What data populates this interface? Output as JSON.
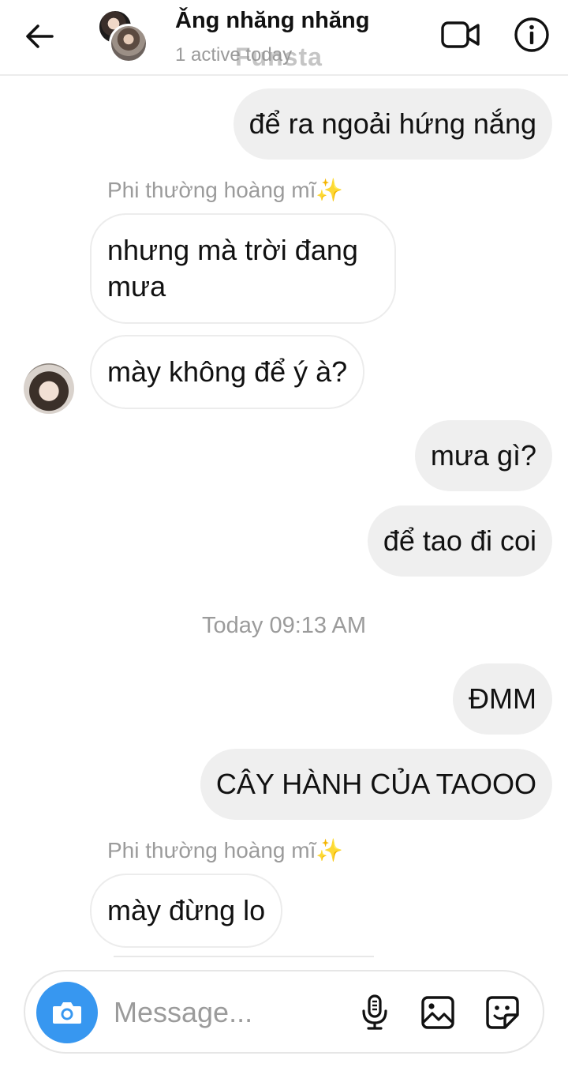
{
  "header": {
    "title": "Ǎng nhăng nhăng",
    "status": "1 active today",
    "watermark": "Funsta",
    "icons": [
      "back-arrow-icon",
      "video-call-icon",
      "info-icon"
    ]
  },
  "messages": [
    {
      "from": "me",
      "text": "để ra ngoải hứng nắng"
    },
    {
      "sender_label": "Phi thường hoàng mĩ",
      "sender_emoji": "✨"
    },
    {
      "from": "other",
      "text_line1": "nhưng mà trời đang",
      "text_line2": "mưa"
    },
    {
      "from": "other",
      "text": "mày không để ý à?"
    },
    {
      "from": "me",
      "text": "mưa gì?"
    },
    {
      "from": "me",
      "text": "để tao đi coi"
    },
    {
      "timestamp": "Today 09:13 AM"
    },
    {
      "from": "me",
      "text": "ĐMM"
    },
    {
      "from": "me",
      "text": "CÂY HÀNH CỦA TAOOO"
    },
    {
      "sender_label": "Phi thường hoàng mĩ",
      "sender_emoji": "✨"
    },
    {
      "from": "other",
      "text": "mày đừng lo"
    }
  ],
  "composer": {
    "placeholder": "Message...",
    "icons": [
      "camera-icon",
      "microphone-icon",
      "gallery-icon",
      "sticker-icon"
    ],
    "accent_color": "#3797f0"
  },
  "colors": {
    "outgoing_bubble": "#efefef",
    "incoming_border": "#ececec",
    "secondary_text": "#9b9b9b"
  }
}
